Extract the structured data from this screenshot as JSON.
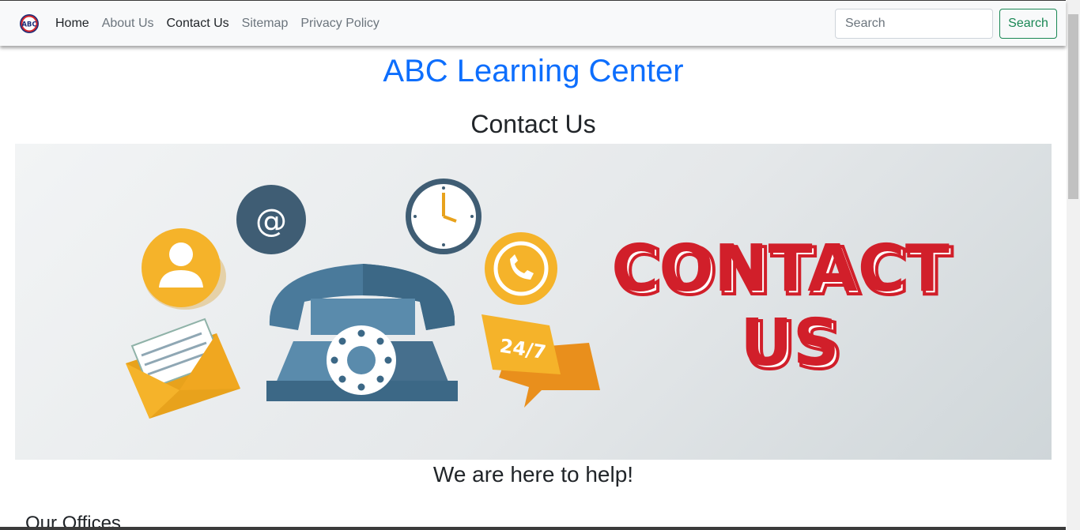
{
  "navbar": {
    "brand_text": "ABC",
    "links": [
      {
        "label": "Home"
      },
      {
        "label": "About Us"
      },
      {
        "label": "Contact Us"
      },
      {
        "label": "Sitemap"
      },
      {
        "label": "Privacy Policy"
      }
    ],
    "search": {
      "placeholder": "Search",
      "value": "",
      "button_label": "Search"
    }
  },
  "main": {
    "site_title": "ABC Learning Center",
    "page_heading": "Contact Us",
    "hero_image": {
      "headline_line1": "CONTACT",
      "headline_line2": "US",
      "badge_text": "24/7",
      "email_symbol": "@"
    },
    "help_heading": "We are here to help!",
    "offices_heading": "Our Offices"
  },
  "colors": {
    "title_blue": "#0d6efd",
    "success_green": "#198754",
    "navbar_bg": "#f8f9fa",
    "contact_red": "#d11f2a",
    "icon_yellow": "#f5b32a",
    "phone_blue": "#4a7a9b"
  }
}
